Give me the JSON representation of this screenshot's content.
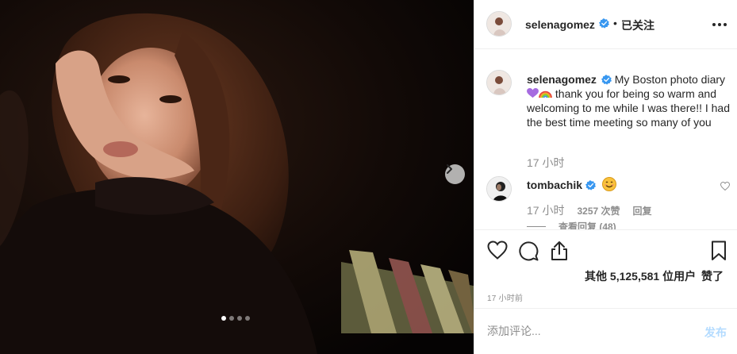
{
  "header": {
    "username": "selenagomez",
    "bullet": "•",
    "follow_status": "已关注"
  },
  "caption": {
    "username": "selenagomez",
    "text_before_emoji": "My Boston photo diary",
    "text_after_emoji": "thank you for being so warm and welcoming to me while I was there!! I had the best time meeting so many of you",
    "time": "17 小时"
  },
  "comment": {
    "username": "tombachik",
    "emoji": "smiling-face-emoji",
    "time": "17 小时",
    "likes": "3257 次赞",
    "reply": "回复",
    "view_replies": "查看回复 (48)"
  },
  "actions": {
    "likes_prefix": "其他",
    "likes_count": "5,125,581",
    "likes_middle": "位用户",
    "likes_suffix": "赞了",
    "post_time": "17 小时前"
  },
  "add_comment": {
    "placeholder": "添加评论...",
    "post_label": "发布"
  },
  "carousel": {
    "dots_total": 4,
    "active_index": 0
  },
  "colors": {
    "verified": "#3897f0",
    "post_button_disabled": "#b3dbff",
    "secondary_text": "#8e8e8e"
  }
}
